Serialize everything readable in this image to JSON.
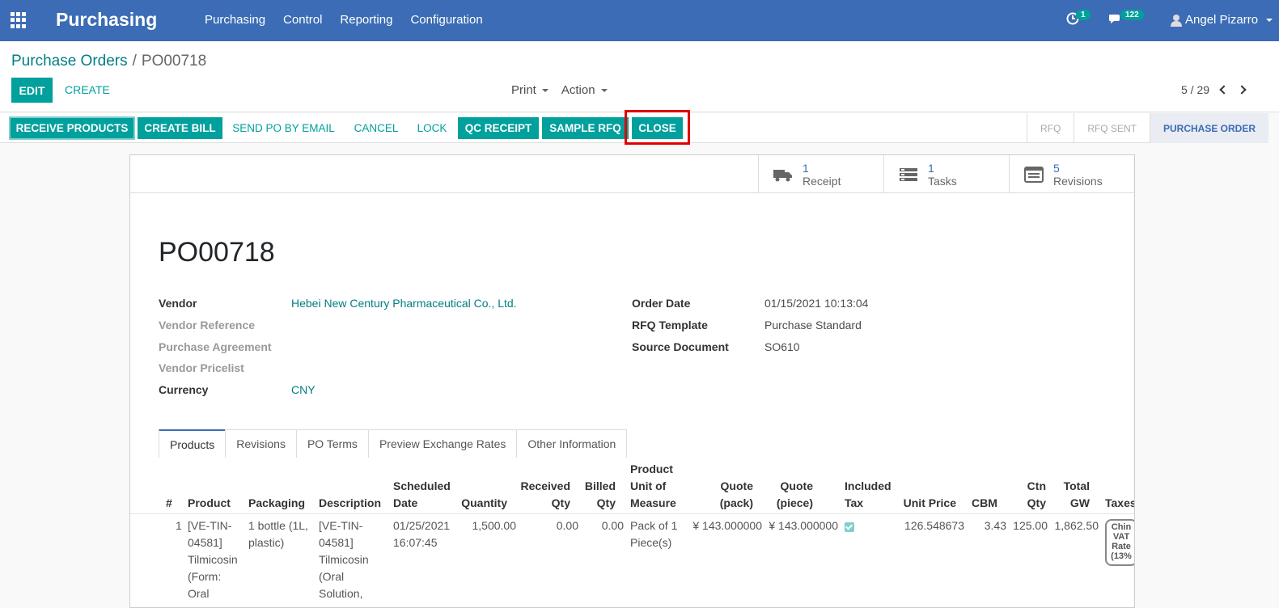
{
  "nav": {
    "brand": "Purchasing",
    "menu": [
      "Purchasing",
      "Control",
      "Reporting",
      "Configuration"
    ],
    "activity_count": "1",
    "message_count": "122",
    "user": "Angel Pizarro"
  },
  "control": {
    "breadcrumb_parent": "Purchase Orders",
    "breadcrumb_sep": "/",
    "breadcrumb_current": "PO00718",
    "edit": "EDIT",
    "create": "CREATE",
    "print": "Print",
    "action": "Action",
    "pager": "5 / 29"
  },
  "statusbar": {
    "buttons": [
      "RECEIVE PRODUCTS",
      "CREATE BILL",
      "SEND PO BY EMAIL",
      "CANCEL",
      "LOCK",
      "QC RECEIPT",
      "SAMPLE RFQ",
      "CLOSE"
    ],
    "stages": [
      "RFQ",
      "RFQ SENT",
      "PURCHASE ORDER"
    ],
    "active_stage": "PURCHASE ORDER"
  },
  "smart_buttons": [
    {
      "count": "1",
      "label": "Receipt",
      "icon": "truck-icon"
    },
    {
      "count": "1",
      "label": "Tasks",
      "icon": "tasks-icon"
    },
    {
      "count": "5",
      "label": "Revisions",
      "icon": "revisions-icon"
    }
  ],
  "form": {
    "reference": "PO00718",
    "left": [
      {
        "label": "Vendor",
        "value": "Hebei New Century Pharmaceutical Co., Ltd."
      },
      {
        "label": "Vendor Reference",
        "value": ""
      },
      {
        "label": "Purchase Agreement",
        "value": ""
      },
      {
        "label": "Vendor Pricelist",
        "value": ""
      },
      {
        "label": "Currency",
        "value": "CNY"
      }
    ],
    "right": [
      {
        "label": "Order Date",
        "value": "01/15/2021 10:13:04"
      },
      {
        "label": "RFQ Template",
        "value": "Purchase Standard"
      },
      {
        "label": "Source Document",
        "value": "SO610"
      }
    ]
  },
  "tabs": [
    "Products",
    "Revisions",
    "PO Terms",
    "Preview Exchange Rates",
    "Other Information"
  ],
  "active_tab": "Products",
  "table": {
    "headers": {
      "num": "#",
      "product": "Product",
      "packaging": "Packaging",
      "description": "Description",
      "scheduled_1": "Scheduled",
      "scheduled_2": "Date",
      "quantity": "Quantity",
      "received_1": "Received",
      "received_2": "Qty",
      "billed_1": "Billed",
      "billed_2": "Qty",
      "uom_1": "Product",
      "uom_2": "Unit of",
      "uom_3": "Measure",
      "quote_pack_1": "Quote",
      "quote_pack_2": "(pack)",
      "quote_piece_1": "Quote",
      "quote_piece_2": "(piece)",
      "included_1": "Included",
      "included_2": "Tax",
      "unit_price": "Unit Price",
      "cbm": "CBM",
      "ctn_1": "Ctn",
      "ctn_2": "Qty",
      "gw_1": "Total",
      "gw_2": "GW",
      "taxes": "Taxes"
    },
    "row": {
      "num": "1",
      "product_lines": [
        "[VE-TIN-",
        "04581]",
        "Tilmicosin",
        "(Form:",
        "Oral"
      ],
      "packaging_lines": [
        "1 bottle (1L,",
        "plastic)"
      ],
      "description_lines": [
        "[VE-TIN-",
        "04581]",
        "Tilmicosin",
        "(Oral",
        "Solution,"
      ],
      "date_lines": [
        "01/25/2021",
        "16:07:45"
      ],
      "quantity": "1,500.00",
      "received": "0.00",
      "billed": "0.00",
      "uom_lines": [
        "Pack of 1",
        "Piece(s)"
      ],
      "quote_pack": "¥ 143.000000",
      "quote_piece": "¥ 143.000000",
      "included_tax": true,
      "unit_price": "126.548673",
      "cbm": "3.43",
      "ctn_qty": "125.00",
      "total_gw": "1,862.50",
      "tax_lines": [
        "Chin",
        "VAT",
        "Rate",
        "(13%"
      ]
    }
  }
}
